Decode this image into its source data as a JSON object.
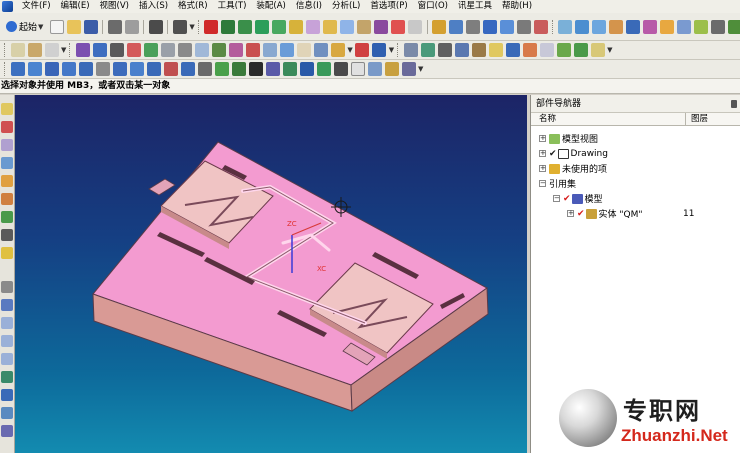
{
  "menu": [
    "文件(F)",
    "编辑(E)",
    "视图(V)",
    "插入(S)",
    "格式(R)",
    "工具(T)",
    "装配(A)",
    "信息(I)",
    "分析(L)",
    "首选项(P)",
    "窗口(O)",
    "讯星工具",
    "帮助(H)"
  ],
  "toolbar": {
    "start_label": "起始"
  },
  "cue_line": "选择对象并使用 MB3，或者双击某一对象",
  "navigator": {
    "title": "部件导航器",
    "col_name": "名称",
    "col_layer": "图层",
    "items": [
      {
        "label": "模型视图"
      },
      {
        "label": "Drawing"
      },
      {
        "label": "未使用的项"
      },
      {
        "label": "引用集"
      },
      {
        "label": "模型"
      },
      {
        "label": "实体 \"QM\"",
        "layer": "11"
      }
    ]
  },
  "viewport": {
    "axis_label_1": "ZC",
    "axis_label_2": "XC"
  },
  "watermark": {
    "text_cn": "专职网",
    "text_en": "Zhuanzhi.Net"
  },
  "colors": {
    "part_top": "#f39bd0",
    "part_side": "#d99a95",
    "background_top": "#1c2466",
    "background_bottom": "#138bb0"
  }
}
